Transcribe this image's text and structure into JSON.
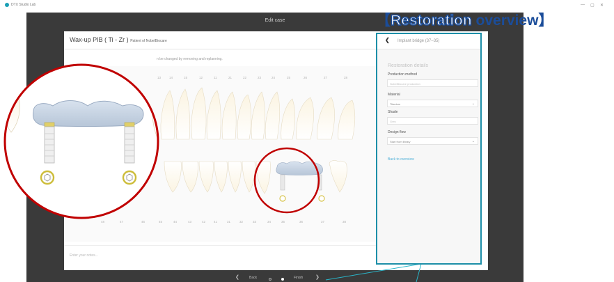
{
  "app": {
    "title": "DTX Studio Lab"
  },
  "window": {
    "minimize": "—",
    "maximize": "▢",
    "close": "✕"
  },
  "dialog": {
    "title": "Edit case"
  },
  "case": {
    "title": "Wax-up PIB ( Ti - Zr )",
    "patient": "Patient of NobelBiocare"
  },
  "hint": "n be changed by removing and replanning.",
  "upper_numbers": [
    "13",
    "14",
    "15",
    "12",
    "11",
    "21",
    "22",
    "23",
    "24",
    "25",
    "26",
    "27",
    "28"
  ],
  "lower_numbers": [
    "48",
    "47",
    "46",
    "45",
    "44",
    "43",
    "42",
    "41",
    "31",
    "32",
    "33",
    "34",
    "35",
    "36",
    "37",
    "38"
  ],
  "notes_placeholder": "Enter your notes...",
  "panel": {
    "back_label": "Implant bridge (37–35)",
    "section": "Restoration details",
    "production_method_label": "Production method",
    "production_method_value": "NobelBiocare production",
    "material_label": "Material",
    "material_value": "Titanium",
    "shade_label": "Shade",
    "shade_value": "Grey",
    "design_flow_label": "Design flow",
    "design_flow_value": "Start from library",
    "back_to_overview": "Back to overview"
  },
  "footer": {
    "back": "Back",
    "finish": "Finish"
  },
  "overlay": {
    "title_bracket_open": "【",
    "title_word1": "Restoration",
    "title_word2": " overview",
    "title_bracket_close": "】"
  },
  "colors": {
    "accent": "#1a9fb5",
    "highlight_ring": "#c00000",
    "link": "#4fb0d8"
  }
}
